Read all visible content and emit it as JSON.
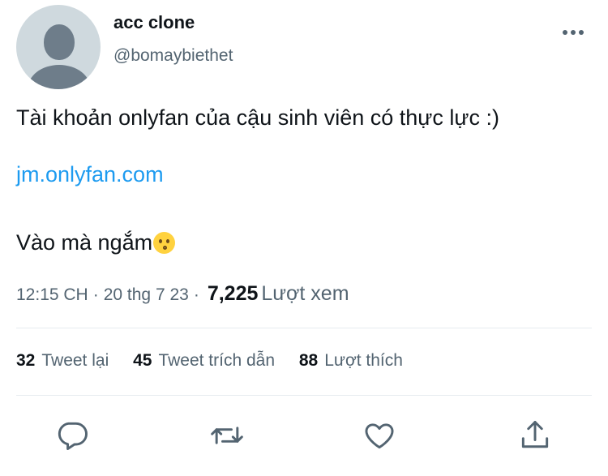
{
  "user": {
    "display_name": "acc clone",
    "handle": "@bomaybiethet"
  },
  "tweet": {
    "line1": "Tài khoản onlyfan của cậu sinh viên có thực lực :)",
    "link": "jm.onlyfan.com",
    "line3": "Vào mà ngắm",
    "emoji": "kissing-face-emoji"
  },
  "meta": {
    "time": "12:15 CH",
    "separator": "·",
    "date": "20 thg 7 23",
    "views_count": "7,225",
    "views_label": "Lượt xem"
  },
  "stats": {
    "retweets_count": "32",
    "retweets_label": "Tweet lại",
    "quotes_count": "45",
    "quotes_label": "Tweet trích dẫn",
    "likes_count": "88",
    "likes_label": "Lượt thích"
  },
  "icons": {
    "more": "more-horizontal-icon",
    "reply": "reply-icon",
    "retweet": "retweet-icon",
    "like": "heart-icon",
    "share": "share-icon"
  },
  "colors": {
    "link": "#1d9bf0",
    "secondary_text": "#536471",
    "primary_text": "#0f1419",
    "avatar_bg": "#cfd9de"
  }
}
